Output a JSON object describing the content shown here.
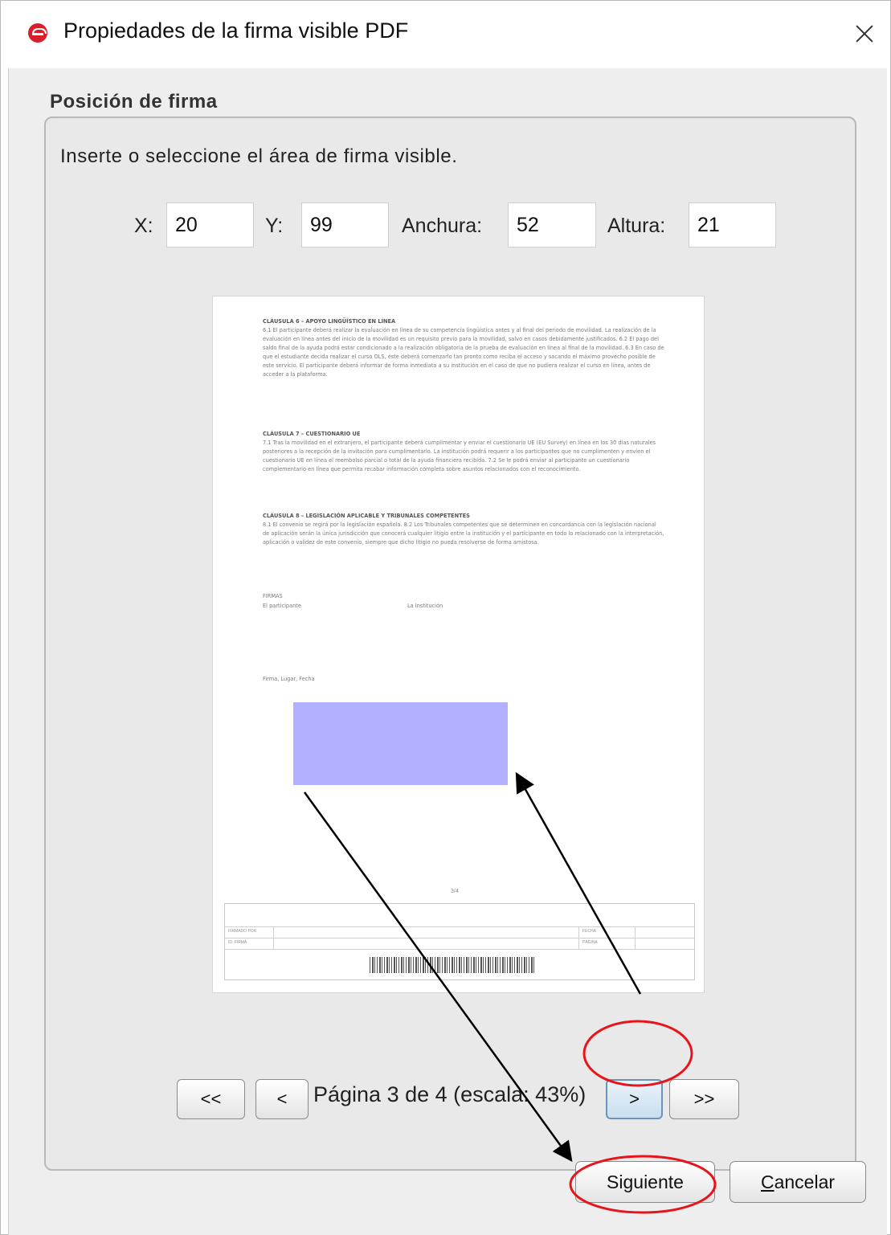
{
  "window": {
    "title": "Propiedades de la firma visible PDF"
  },
  "section": {
    "title": "Posición de firma",
    "instruction": "Inserte o seleccione el área de firma visible."
  },
  "fields": {
    "x": {
      "label": "X:",
      "value": "20"
    },
    "y": {
      "label": "Y:",
      "value": "99"
    },
    "width": {
      "label": "Anchura:",
      "value": "52"
    },
    "height": {
      "label": "Altura:",
      "value": "21"
    }
  },
  "preview": {
    "clauses": [
      {
        "heading": "CLÁUSULA 6 – APOYO LINGÜÍSTICO EN LÍNEA",
        "body": "6.1 El participante deberá realizar la evaluación en línea de su competencia lingüística antes y al final del periodo de movilidad. La realización de la evaluación en línea antes del inicio de la movilidad es un requisito previo para la movilidad, salvo en casos debidamente justificados. 6.2 El pago del saldo final de la ayuda podrá estar condicionado a la realización obligatoria de la prueba de evaluación en línea al final de la movilidad. 6.3 En caso de que el estudiante decida realizar el curso OLS, éste deberá comenzarlo tan pronto como reciba el acceso y sacando el máximo provecho posible de este servicio. El participante deberá informar de forma inmediata a su institución en el caso de que no pudiera realizar el curso en línea, antes de acceder a la plataforma."
      },
      {
        "heading": "CLÁUSULA 7 – CUESTIONARIO UE",
        "body": "7.1 Tras la movilidad en el extranjero, el participante deberá cumplimentar y enviar el cuestionario UE (EU Survey) en línea en los 30 días naturales posteriores a la recepción de la invitación para cumplimentarlo. La institución podrá requerir a los participantes que no cumplimenten y envíen el cuestionario UE en línea el reembolso parcial o total de la ayuda financiera recibida. 7.2 Se le podrá enviar al participante un cuestionario complementario en línea que permita recabar información completa sobre asuntos relacionados con el reconocimiento."
      },
      {
        "heading": "CLÁUSULA 8 – LEGISLACIÓN APLICABLE Y TRIBUNALES COMPETENTES",
        "body": "8.1 El convenio se regirá por la legislación española. 8.2 Los Tribunales competentes que se determinen en concordancia con la legislación nacional de aplicación serán la única jurisdicción que conocerá cualquier litigio entre la institución y el participante en todo lo relacionado con la interpretación, aplicación o validez de este convenio, siempre que dicho litigio no pueda resolverse de forma amistosa."
      }
    ],
    "signatures_heading": "FIRMAS",
    "participant_label": "El participante",
    "institution_label": "La Institución",
    "place_date_label": "Firma, Lugar, Fecha",
    "page_number": "3/4",
    "footer_row1_col1": "FIRMADO POR",
    "footer_row1_col3": "FECHA",
    "footer_row2_col1": "ID. FIRMA",
    "footer_row2_col3": "PÁGINA"
  },
  "navigation": {
    "first_label": "<<",
    "prev_label": "<",
    "page_info": "Página 3 de 4 (escala: 43%)",
    "next_label": ">",
    "last_label": ">>"
  },
  "actions": {
    "next_label": "Siguiente",
    "cancel_mnemonic": "C",
    "cancel_rest": "ancelar"
  },
  "colors": {
    "signature_area": "#b0b0ff",
    "annotation_circle": "#e8141c",
    "annotation_arrow": "#000000",
    "app_icon": "#d8202a"
  }
}
